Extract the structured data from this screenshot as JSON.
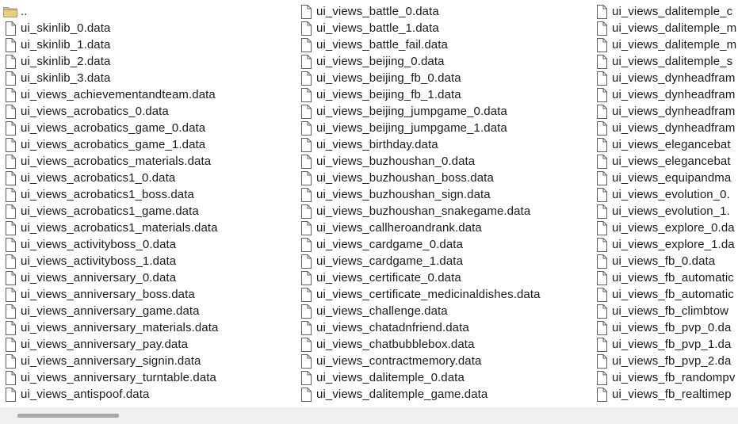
{
  "file_list": {
    "columns": [
      {
        "items": [
          {
            "label": "..",
            "icon": "folder-icon"
          },
          {
            "label": "ui_skinlib_0.data",
            "icon": "file-icon"
          },
          {
            "label": "ui_skinlib_1.data",
            "icon": "file-icon"
          },
          {
            "label": "ui_skinlib_2.data",
            "icon": "file-icon"
          },
          {
            "label": "ui_skinlib_3.data",
            "icon": "file-icon"
          },
          {
            "label": "ui_views_achievementandteam.data",
            "icon": "file-icon"
          },
          {
            "label": "ui_views_acrobatics_0.data",
            "icon": "file-icon"
          },
          {
            "label": "ui_views_acrobatics_game_0.data",
            "icon": "file-icon"
          },
          {
            "label": "ui_views_acrobatics_game_1.data",
            "icon": "file-icon"
          },
          {
            "label": "ui_views_acrobatics_materials.data",
            "icon": "file-icon"
          },
          {
            "label": "ui_views_acrobatics1_0.data",
            "icon": "file-icon"
          },
          {
            "label": "ui_views_acrobatics1_boss.data",
            "icon": "file-icon"
          },
          {
            "label": "ui_views_acrobatics1_game.data",
            "icon": "file-icon"
          },
          {
            "label": "ui_views_acrobatics1_materials.data",
            "icon": "file-icon"
          },
          {
            "label": "ui_views_activityboss_0.data",
            "icon": "file-icon"
          },
          {
            "label": "ui_views_activityboss_1.data",
            "icon": "file-icon"
          },
          {
            "label": "ui_views_anniversary_0.data",
            "icon": "file-icon"
          },
          {
            "label": "ui_views_anniversary_boss.data",
            "icon": "file-icon"
          },
          {
            "label": "ui_views_anniversary_game.data",
            "icon": "file-icon"
          },
          {
            "label": "ui_views_anniversary_materials.data",
            "icon": "file-icon"
          },
          {
            "label": "ui_views_anniversary_pay.data",
            "icon": "file-icon"
          },
          {
            "label": "ui_views_anniversary_signin.data",
            "icon": "file-icon"
          },
          {
            "label": "ui_views_anniversary_turntable.data",
            "icon": "file-icon"
          },
          {
            "label": "ui_views_antispoof.data",
            "icon": "file-icon"
          }
        ]
      },
      {
        "items": [
          {
            "label": "ui_views_battle_0.data",
            "icon": "file-icon"
          },
          {
            "label": "ui_views_battle_1.data",
            "icon": "file-icon"
          },
          {
            "label": "ui_views_battle_fail.data",
            "icon": "file-icon"
          },
          {
            "label": "ui_views_beijing_0.data",
            "icon": "file-icon"
          },
          {
            "label": "ui_views_beijing_fb_0.data",
            "icon": "file-icon"
          },
          {
            "label": "ui_views_beijing_fb_1.data",
            "icon": "file-icon"
          },
          {
            "label": "ui_views_beijing_jumpgame_0.data",
            "icon": "file-icon"
          },
          {
            "label": "ui_views_beijing_jumpgame_1.data",
            "icon": "file-icon"
          },
          {
            "label": "ui_views_birthday.data",
            "icon": "file-icon"
          },
          {
            "label": "ui_views_buzhoushan_0.data",
            "icon": "file-icon"
          },
          {
            "label": "ui_views_buzhoushan_boss.data",
            "icon": "file-icon"
          },
          {
            "label": "ui_views_buzhoushan_sign.data",
            "icon": "file-icon"
          },
          {
            "label": "ui_views_buzhoushan_snakegame.data",
            "icon": "file-icon"
          },
          {
            "label": "ui_views_callheroandrank.data",
            "icon": "file-icon"
          },
          {
            "label": "ui_views_cardgame_0.data",
            "icon": "file-icon"
          },
          {
            "label": "ui_views_cardgame_1.data",
            "icon": "file-icon"
          },
          {
            "label": "ui_views_certificate_0.data",
            "icon": "file-icon"
          },
          {
            "label": "ui_views_certificate_medicinaldishes.data",
            "icon": "file-icon"
          },
          {
            "label": "ui_views_challenge.data",
            "icon": "file-icon"
          },
          {
            "label": "ui_views_chatadnfriend.data",
            "icon": "file-icon"
          },
          {
            "label": "ui_views_chatbubblebox.data",
            "icon": "file-icon"
          },
          {
            "label": "ui_views_contractmemory.data",
            "icon": "file-icon"
          },
          {
            "label": "ui_views_dalitemple_0.data",
            "icon": "file-icon"
          },
          {
            "label": "ui_views_dalitemple_game.data",
            "icon": "file-icon"
          }
        ]
      },
      {
        "items": [
          {
            "label": "ui_views_dalitemple_c",
            "icon": "file-icon"
          },
          {
            "label": "ui_views_dalitemple_m",
            "icon": "file-icon"
          },
          {
            "label": "ui_views_dalitemple_m",
            "icon": "file-icon"
          },
          {
            "label": "ui_views_dalitemple_s",
            "icon": "file-icon"
          },
          {
            "label": "ui_views_dynheadfram",
            "icon": "file-icon"
          },
          {
            "label": "ui_views_dynheadfram",
            "icon": "file-icon"
          },
          {
            "label": "ui_views_dynheadfram",
            "icon": "file-icon"
          },
          {
            "label": "ui_views_dynheadfram",
            "icon": "file-icon"
          },
          {
            "label": "ui_views_elegancebat",
            "icon": "file-icon"
          },
          {
            "label": "ui_views_elegancebat",
            "icon": "file-icon"
          },
          {
            "label": "ui_views_equipandma",
            "icon": "file-icon"
          },
          {
            "label": "ui_views_evolution_0.",
            "icon": "file-icon"
          },
          {
            "label": "ui_views_evolution_1.",
            "icon": "file-icon"
          },
          {
            "label": "ui_views_explore_0.da",
            "icon": "file-icon"
          },
          {
            "label": "ui_views_explore_1.da",
            "icon": "file-icon"
          },
          {
            "label": "ui_views_fb_0.data",
            "icon": "file-icon"
          },
          {
            "label": "ui_views_fb_automatic",
            "icon": "file-icon"
          },
          {
            "label": "ui_views_fb_automatic",
            "icon": "file-icon"
          },
          {
            "label": "ui_views_fb_climbtow",
            "icon": "file-icon"
          },
          {
            "label": "ui_views_fb_pvp_0.da",
            "icon": "file-icon"
          },
          {
            "label": "ui_views_fb_pvp_1.da",
            "icon": "file-icon"
          },
          {
            "label": "ui_views_fb_pvp_2.da",
            "icon": "file-icon"
          },
          {
            "label": "ui_views_fb_randompv",
            "icon": "file-icon"
          },
          {
            "label": "ui_views_fb_realtimep",
            "icon": "file-icon"
          }
        ]
      }
    ]
  },
  "colors": {
    "background": "#ffffff",
    "text": "#1a1a1a",
    "folder_fill": "#d8c27a",
    "file_outline": "#5f5f5f",
    "scrollbar_track": "#f0f0f0",
    "scrollbar_thumb": "#a7a7a7"
  }
}
